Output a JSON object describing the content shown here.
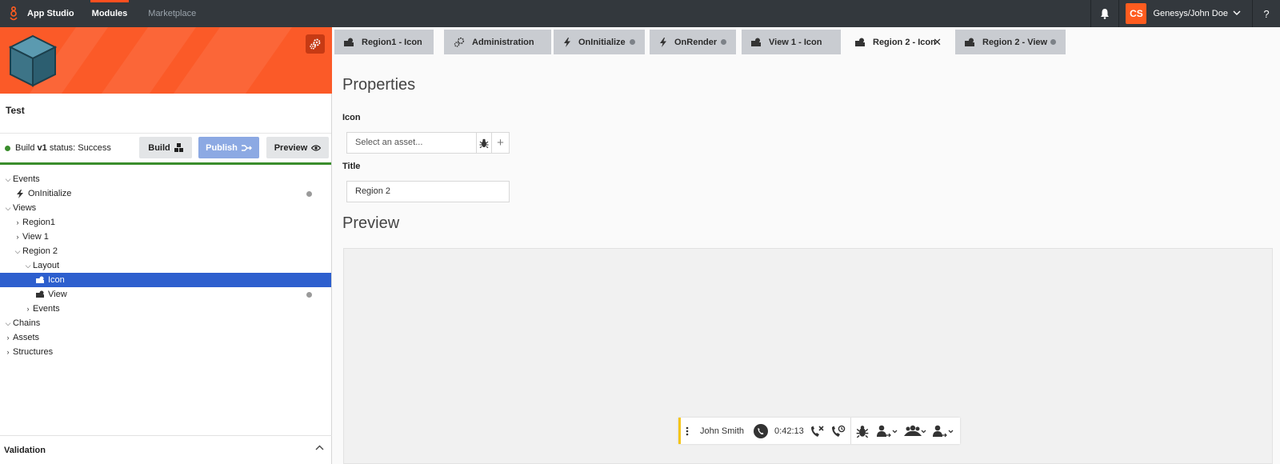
{
  "topbar": {
    "app_title": "App Studio",
    "nav": [
      {
        "label": "Modules",
        "active": true
      },
      {
        "label": "Marketplace",
        "active": false
      }
    ],
    "avatar_initials": "CS",
    "user_name": "Genesys/John Doe",
    "help_label": "?"
  },
  "left": {
    "project_name": "Test",
    "build_status_prefix": "Build ",
    "build_version": "v1",
    "build_status_suffix": " status: Success",
    "buttons": {
      "build": "Build",
      "publish": "Publish",
      "preview": "Preview"
    },
    "tree": {
      "events": "Events",
      "on_initialize": "OnInitialize",
      "views": "Views",
      "region1": "Region1",
      "view1": "View 1",
      "region2": "Region 2",
      "layout": "Layout",
      "icon": "Icon",
      "view": "View",
      "region2_events": "Events",
      "chains": "Chains",
      "assets": "Assets",
      "structures": "Structures"
    },
    "validation_label": "Validation"
  },
  "tabs": [
    {
      "label": "Region1 - Icon",
      "icon": "puzzle-icon"
    },
    {
      "label": "Administration",
      "icon": "gears-icon"
    },
    {
      "label": "OnInitialize",
      "icon": "bolt-icon",
      "modified": true
    },
    {
      "label": "OnRender",
      "icon": "bolt-icon",
      "modified": true
    },
    {
      "label": "View 1 - Icon",
      "icon": "puzzle-icon"
    },
    {
      "label": "Region 2 - Icon",
      "icon": "puzzle-icon",
      "active": true
    },
    {
      "label": "Region 2 - View",
      "icon": "puzzle-icon",
      "modified": true
    }
  ],
  "main": {
    "properties_heading": "Properties",
    "icon_label": "Icon",
    "asset_placeholder": "Select an asset...",
    "title_label": "Title",
    "title_value": "Region 2",
    "preview_heading": "Preview",
    "call": {
      "name": "John Smith",
      "time": "0:42:13"
    }
  },
  "colors": {
    "topbar": "#33383d",
    "accent": "#ff5c1f",
    "selection": "#2d5fce",
    "success": "#3a8d2c"
  }
}
